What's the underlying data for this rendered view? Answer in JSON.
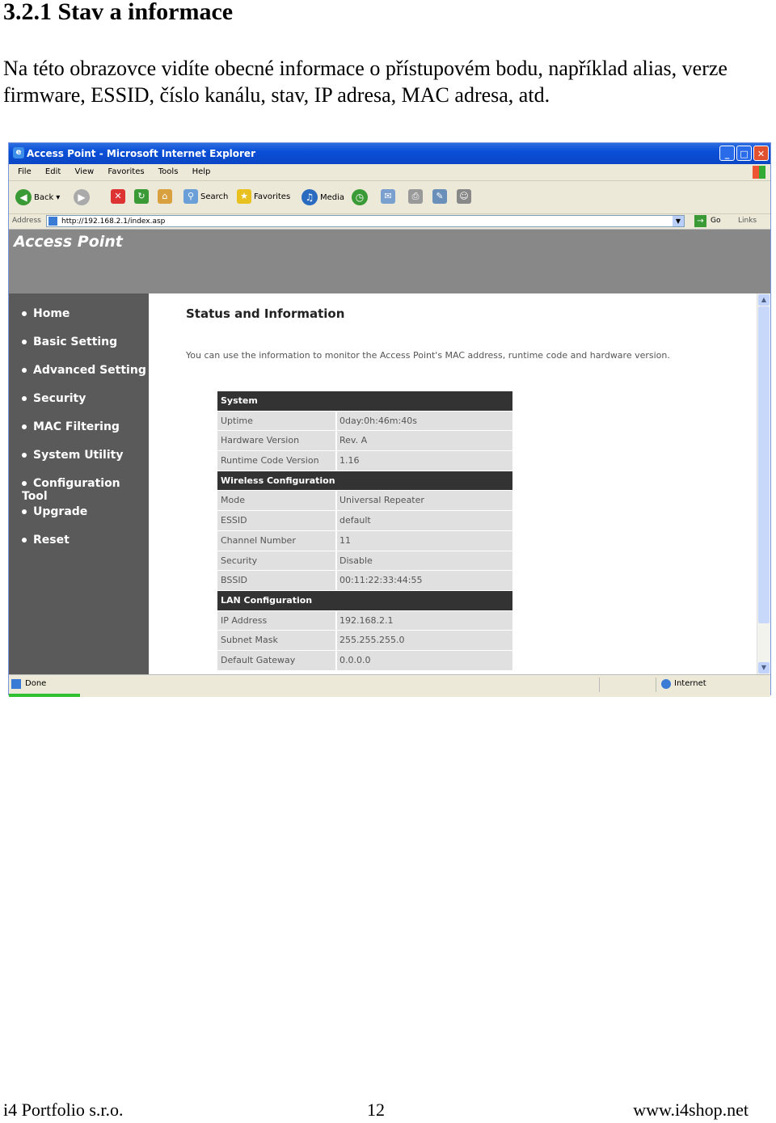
{
  "doc": {
    "heading": "3.2.1 Stav a informace",
    "intro": "Na této obrazovce vidíte obecné informace o přístupovém bodu, například alias, verze firmware, ESSID, číslo kanálu, stav, IP adresa, MAC adresa, atd."
  },
  "browser": {
    "title": "Access Point - Microsoft Internet Explorer",
    "menu": [
      "File",
      "Edit",
      "View",
      "Favorites",
      "Tools",
      "Help"
    ],
    "toolbar": {
      "back": "Back",
      "search": "Search",
      "favorites": "Favorites",
      "media": "Media"
    },
    "address_label": "Address",
    "url": "http://192.168.2.1/index.asp",
    "go": "Go",
    "links": "Links",
    "status": "Done",
    "zone": "Internet"
  },
  "page": {
    "brand": "Access Point",
    "nav": [
      "Home",
      "Basic Setting",
      "Advanced Setting",
      "Security",
      "MAC Filtering",
      "System Utility",
      "Configuration Tool",
      "Upgrade",
      "Reset"
    ],
    "title": "Status and Information",
    "description": "You can use the information to monitor the Access Point's MAC address, runtime code and hardware version.",
    "sections": {
      "system": "System",
      "wireless": "Wireless Configuration",
      "lan": "LAN Configuration"
    },
    "system": {
      "uptime_k": "Uptime",
      "uptime_v": "0day:0h:46m:40s",
      "hw_k": "Hardware Version",
      "hw_v": "Rev. A",
      "rt_k": "Runtime Code Version",
      "rt_v": "1.16"
    },
    "wireless": {
      "mode_k": "Mode",
      "mode_v": "Universal Repeater",
      "essid_k": "ESSID",
      "essid_v": "default",
      "ch_k": "Channel Number",
      "ch_v": "11",
      "sec_k": "Security",
      "sec_v": "Disable",
      "bssid_k": "BSSID",
      "bssid_v": "00:11:22:33:44:55"
    },
    "lan": {
      "ip_k": "IP Address",
      "ip_v": "192.168.2.1",
      "mask_k": "Subnet Mask",
      "mask_v": "255.255.255.0",
      "gw_k": "Default Gateway",
      "gw_v": "0.0.0.0"
    }
  },
  "footer": {
    "company": "i4 Portfolio s.r.o.",
    "page": "12",
    "web": "www.i4shop.net"
  }
}
